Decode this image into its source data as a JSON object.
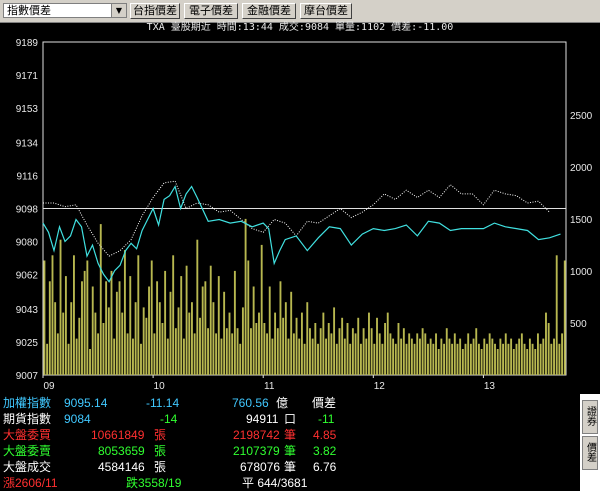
{
  "toolbar": {
    "selector_value": "指數價差",
    "buttons": [
      "台指價差",
      "電子價差",
      "金融價差",
      "摩台價差"
    ]
  },
  "title": "TXA  臺股期近 時間:13:44 成交:9084 單量:1102 價差:-11.00",
  "colors": {
    "index_line": "#ffffff",
    "futures_line": "#40e0e0",
    "volume": "#b8b850",
    "axis_top": "#ff3030",
    "axis_bottom": "#30ff30",
    "up": "#ff3030",
    "down": "#30ff30"
  },
  "chart_data": {
    "type": "line",
    "title": "TXA  臺股期近 時間:13:44 成交:9084 單量:1102 價差:-11.00",
    "y_left_ticks": [
      "9189",
      "9171",
      "9153",
      "9134",
      "9116",
      "9098",
      "9080",
      "9062",
      "9043",
      "9025",
      "9007"
    ],
    "y_left_range": [
      9007,
      9189
    ],
    "y_right_ticks": [
      "2500",
      "2000",
      "1500",
      "1000",
      "500"
    ],
    "y_right_range": [
      0,
      3200
    ],
    "x_ticks": [
      "09",
      "10",
      "11",
      "12",
      "13"
    ],
    "x_range": [
      9.0,
      13.75
    ],
    "series": [
      {
        "style": "dotted-white",
        "x": [
          9.0,
          9.1,
          9.2,
          9.3,
          9.4,
          9.5,
          9.6,
          9.7,
          9.8,
          9.9,
          10.0,
          10.1,
          10.2,
          10.3,
          10.4,
          10.5,
          10.6,
          10.7,
          10.8,
          10.9,
          11.0,
          11.1,
          11.2,
          11.3,
          11.4,
          11.5,
          11.6,
          11.7,
          11.8,
          11.9,
          12.0,
          12.1,
          12.2,
          12.3,
          12.4,
          12.5,
          12.6,
          12.7,
          12.8,
          12.9,
          13.0,
          13.1,
          13.2,
          13.3,
          13.4,
          13.5,
          13.6
        ],
        "values": [
          9101,
          9101,
          9099,
          9100,
          9089,
          9079,
          9072,
          9075,
          9081,
          9094,
          9104,
          9112,
          9113,
          9098,
          9101,
          9100,
          9096,
          9097,
          9092,
          9087,
          9085,
          9092,
          9090,
          9083,
          9091,
          9090,
          9094,
          9098,
          9093,
          9096,
          9100,
          9106,
          9103,
          9108,
          9104,
          9108,
          9104,
          9111,
          9106,
          9106,
          9100,
          9108,
          9106,
          9105,
          9101,
          9102,
          9096
        ]
      },
      {
        "style": "solid-cyan",
        "x": [
          9.0,
          9.05,
          9.1,
          9.15,
          9.2,
          9.25,
          9.3,
          9.35,
          9.4,
          9.45,
          9.5,
          9.55,
          9.6,
          9.65,
          9.7,
          9.75,
          9.8,
          9.85,
          9.9,
          9.95,
          10.0,
          10.05,
          10.1,
          10.15,
          10.2,
          10.25,
          10.3,
          10.35,
          10.4,
          10.5,
          10.6,
          10.7,
          10.8,
          10.9,
          11.0,
          11.05,
          11.1,
          11.15,
          11.2,
          11.3,
          11.4,
          11.5,
          11.6,
          11.7,
          11.8,
          11.9,
          12.0,
          12.1,
          12.2,
          12.3,
          12.4,
          12.5,
          12.6,
          12.7,
          12.8,
          12.9,
          13.0,
          13.1,
          13.2,
          13.3,
          13.4,
          13.5,
          13.6,
          13.7
        ],
        "values": [
          9090,
          9085,
          9075,
          9088,
          9080,
          9083,
          9092,
          9088,
          9072,
          9078,
          9068,
          9062,
          9058,
          9064,
          9067,
          9075,
          9079,
          9076,
          9086,
          9092,
          9098,
          9089,
          9103,
          9105,
          9110,
          9098,
          9106,
          9110,
          9104,
          9091,
          9092,
          9090,
          9091,
          9088,
          9090,
          9087,
          9068,
          9075,
          9081,
          9083,
          9075,
          9082,
          9088,
          9087,
          9078,
          9084,
          9087,
          9086,
          9087,
          9089,
          9083,
          9091,
          9090,
          9086,
          9087,
          9087,
          9087,
          9090,
          9088,
          9087,
          9086,
          9081,
          9082,
          9084
        ]
      }
    ],
    "volume": [
      1100,
      300,
      900,
      1150,
      700,
      400,
      1300,
      600,
      950,
      300,
      700,
      1150,
      350,
      550,
      900,
      1000,
      1100,
      250,
      850,
      600,
      400,
      1450,
      500,
      900,
      650,
      1000,
      350,
      800,
      900,
      600,
      1200,
      400,
      950,
      350,
      700,
      1150,
      300,
      650,
      550,
      850,
      1100,
      400,
      900,
      700,
      500,
      1000,
      350,
      800,
      1150,
      450,
      650,
      950,
      350,
      1050,
      600,
      700,
      400,
      1300,
      550,
      850,
      900,
      450,
      1050,
      700,
      400,
      950,
      350,
      800,
      450,
      600,
      400,
      1000,
      450,
      300,
      650,
      1500,
      1100,
      450,
      850,
      500,
      600,
      1250,
      500,
      400,
      850,
      350,
      600,
      450,
      900,
      550,
      700,
      350,
      800,
      400,
      550,
      350,
      600,
      300,
      700,
      450,
      350,
      500,
      300,
      450,
      600,
      350,
      500,
      400,
      650,
      300,
      450,
      550,
      350,
      500,
      300,
      450,
      400,
      550,
      300,
      450,
      350,
      600,
      450,
      300,
      550,
      400,
      300,
      500,
      600,
      400,
      350,
      300,
      500,
      350,
      450,
      300,
      400,
      350,
      300,
      400,
      350,
      450,
      400,
      300,
      350,
      300,
      400,
      250,
      350,
      300,
      450,
      350,
      300,
      400,
      300,
      350,
      250,
      300,
      400,
      300,
      350,
      450,
      300,
      250,
      350,
      300,
      400,
      350,
      300,
      250,
      350,
      300,
      400,
      300,
      350,
      250,
      300,
      350,
      400,
      300,
      250,
      350,
      300,
      250,
      400,
      300,
      350,
      600,
      500,
      300,
      350,
      1150,
      300,
      400,
      1100
    ]
  },
  "rows": [
    {
      "label": "加權指數",
      "v1": "9095.14",
      "v2": "-11.14",
      "v3": "760.56",
      "unit": "億",
      "v4": "價差"
    },
    {
      "label": "期貨指數",
      "v1": "9084",
      "v2": "-14",
      "v3": "94911",
      "unit": "口",
      "v4": "-11"
    },
    {
      "label": "大盤委買",
      "v1": "10661849",
      "u1": "張",
      "v3": "2198742",
      "unit": "筆",
      "v4": "4.85"
    },
    {
      "label": "大盤委賣",
      "v1": "8053659",
      "u1": "張",
      "v3": "2107379",
      "unit": "筆",
      "v4": "3.82"
    },
    {
      "label": "大盤成交",
      "v1": "4584146",
      "u1": "張",
      "v3": "678076",
      "unit": "筆",
      "v4": "6.76"
    }
  ],
  "footer": {
    "up": "漲2606/11",
    "down": "跌3558/19",
    "flat": "平 644/3681"
  },
  "side_tabs": [
    "證券",
    "價差"
  ]
}
